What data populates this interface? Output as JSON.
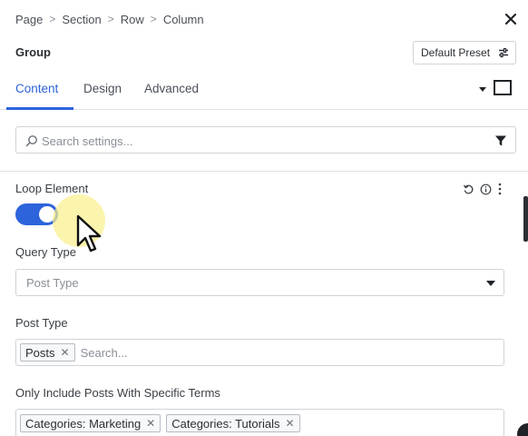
{
  "breadcrumb": {
    "items": [
      "Page",
      "Section",
      "Row",
      "Column"
    ],
    "separator": ">"
  },
  "header": {
    "title": "Group",
    "preset_label": "Default Preset"
  },
  "tabs": [
    {
      "label": "Content",
      "active": true
    },
    {
      "label": "Design",
      "active": false
    },
    {
      "label": "Advanced",
      "active": false
    }
  ],
  "search": {
    "placeholder": "Search settings..."
  },
  "loop_element": {
    "label": "Loop Element",
    "enabled": true
  },
  "query_type": {
    "label": "Query Type",
    "value": "Post Type"
  },
  "post_type": {
    "label": "Post Type",
    "tags": [
      "Posts"
    ],
    "placeholder": "Search..."
  },
  "terms": {
    "label": "Only Include Posts With Specific Terms",
    "tags": [
      "Categories: Marketing",
      "Categories: Tutorials"
    ]
  },
  "colors": {
    "accent": "#2d63db",
    "text": "#2b2f33",
    "border": "#cfd3d8",
    "highlight": "#faf08c"
  }
}
